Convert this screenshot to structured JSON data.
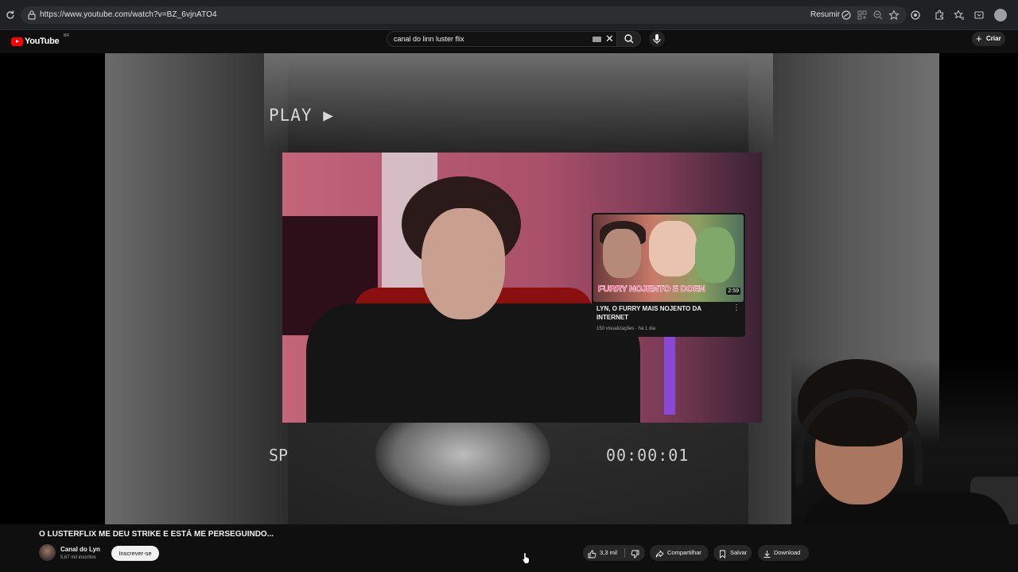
{
  "browser": {
    "url": "https://www.youtube.com/watch?v=BZ_6vjnATO4",
    "summarize_label": "Resumir",
    "icons": [
      "reload-icon",
      "site-info-icon",
      "summarize-icon",
      "apps-icon",
      "zoom-icon",
      "star-icon",
      "extension-icon",
      "extensions-puzzle-icon",
      "favorites-icon",
      "collections-icon",
      "profile-icon"
    ]
  },
  "youtube": {
    "logo_text": "YouTube",
    "country_code": "BR",
    "search": {
      "query": "canal do linn luster flix"
    },
    "create_label": "Criar"
  },
  "video": {
    "overlay_play": "PLAY ▶",
    "overlay_sp": "SP",
    "overlay_timecode": "00:00:01",
    "embedded_card": {
      "thumbnail_text": "FURRY NOJENTO E DOEN",
      "duration": "2:59",
      "title": "LYN, O FURRY MAIS NOJENTO DA INTERNET",
      "meta": "150 visualizações · há 1 dia"
    }
  },
  "info": {
    "title": "O LUSTERFLIX ME DEU STRIKE E ESTÁ ME PERSEGUINDO...",
    "channel_name": "Canal do Lyn",
    "subscribers": "5,67 mil inscritos",
    "subscribe_label": "Inscrever-se",
    "likes": "3,3 mil",
    "share_label": "Compartilhar",
    "save_label": "Salvar",
    "download_label": "Download"
  }
}
